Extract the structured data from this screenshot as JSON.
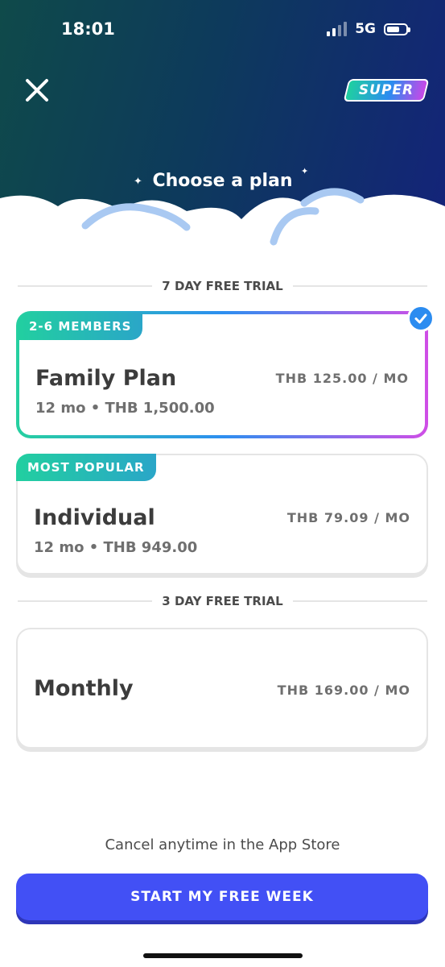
{
  "status_bar": {
    "time": "18:01",
    "network": "5G"
  },
  "header": {
    "close_icon": "close-icon",
    "badge_label": "SUPER",
    "title": "Choose a plan"
  },
  "sections": [
    {
      "label": "7 DAY FREE TRIAL"
    },
    {
      "label": "3 DAY FREE TRIAL"
    }
  ],
  "plans": [
    {
      "tag": "2-6 MEMBERS",
      "name": "Family Plan",
      "detail": "12 mo • THB 1,500.00",
      "price": "THB 125.00 / MO",
      "selected": true
    },
    {
      "tag": "MOST POPULAR",
      "name": "Individual",
      "detail": "12 mo • THB 949.00",
      "price": "THB 79.09 / MO",
      "selected": false
    },
    {
      "name": "Monthly",
      "price": "THB 169.00 / MO",
      "selected": false
    }
  ],
  "footer": {
    "note": "Cancel anytime in the App Store",
    "cta_label": "START MY FREE WEEK"
  },
  "colors": {
    "accent_blue": "#4250f5",
    "check_blue": "#2b8cf0",
    "tag_green": "#22cfa0",
    "hero_dark": "#14237a"
  }
}
